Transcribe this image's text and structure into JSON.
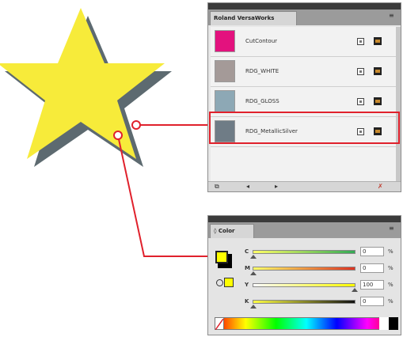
{
  "illustration": {
    "star_fill": "#f7eb3a",
    "star_shadow": "#5d6a70",
    "callout_color": "#e0212c"
  },
  "swatches_panel": {
    "tab_label": "Roland VersaWorks",
    "menu_icon": "panel-menu-icon",
    "items": [
      {
        "name": "CutContour",
        "color": "#e3127e"
      },
      {
        "name": "RDG_WHITE",
        "color": "#a49a98"
      },
      {
        "name": "RDG_GLOSS",
        "color": "#8da8b5"
      },
      {
        "name": "RDG_MetallicSilver",
        "color": "#6f7c86"
      }
    ],
    "selected_index": 3,
    "bottom_buttons": [
      "swatch-library-menu",
      "previous",
      "next",
      "delete"
    ]
  },
  "color_panel": {
    "tab_label": "Color",
    "fill_color": "#ffff00",
    "stroke_color": "#000000",
    "sliders": [
      {
        "label": "C",
        "value": "0",
        "unit": "%",
        "track": "linear-gradient(90deg,#ffff66,#33aa55)",
        "level": 0
      },
      {
        "label": "M",
        "value": "0",
        "unit": "%",
        "track": "linear-gradient(90deg,#ffff66,#dd3322)",
        "level": 0
      },
      {
        "label": "Y",
        "value": "100",
        "unit": "%",
        "track": "linear-gradient(90deg,#ffffff,#ffff00)",
        "level": 100
      },
      {
        "label": "K",
        "value": "0",
        "unit": "%",
        "track": "linear-gradient(90deg,#ffff44,#111111)",
        "level": 0
      }
    ]
  }
}
